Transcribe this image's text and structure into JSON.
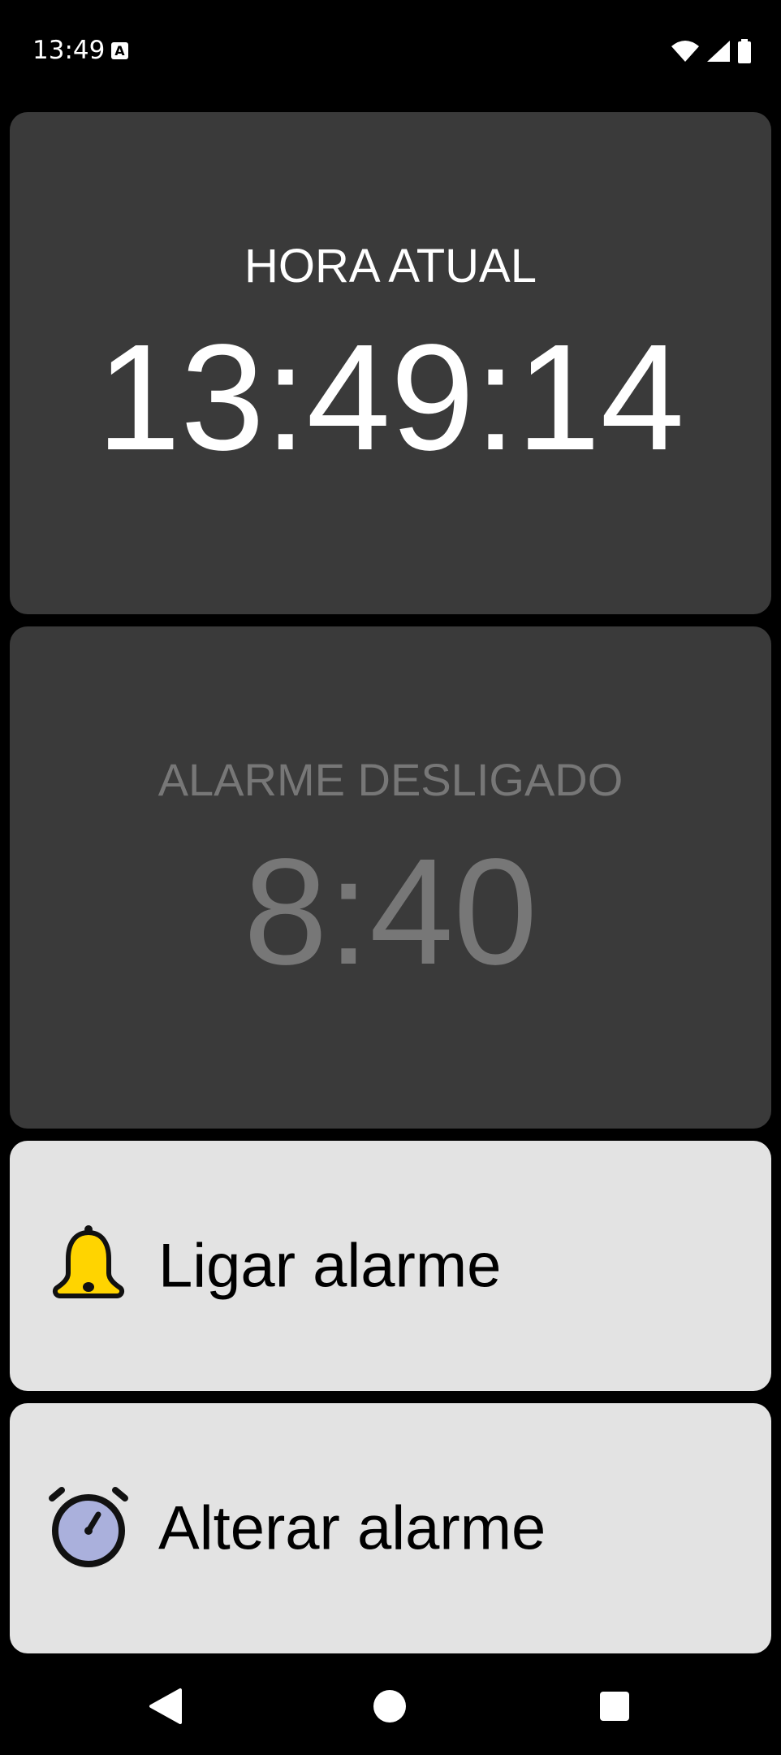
{
  "status_bar": {
    "time": "13:49",
    "notification_icon": "a-icon",
    "notification_letter": "A",
    "icons": [
      "wifi-icon",
      "signal-icon",
      "battery-icon"
    ]
  },
  "current_time_card": {
    "label": "HORA ATUAL",
    "time": "13:49:14"
  },
  "alarm_card": {
    "label": "ALARME DESLIGADO",
    "time": "8:40"
  },
  "toggle_alarm_button": {
    "label": "Ligar alarme",
    "icon": "bell-icon"
  },
  "change_alarm_button": {
    "label": "Alterar alarme",
    "icon": "alarm-clock-icon"
  },
  "nav_bar": {
    "buttons": [
      "back-icon",
      "home-icon",
      "recents-icon"
    ]
  },
  "colors": {
    "background": "#000000",
    "card_dark": "#3a3a3a",
    "card_light": "#e3e3e3",
    "text_primary": "#ffffff",
    "text_disabled": "#777777",
    "bell_yellow": "#ffd400",
    "clock_face": "#aab0dc"
  }
}
